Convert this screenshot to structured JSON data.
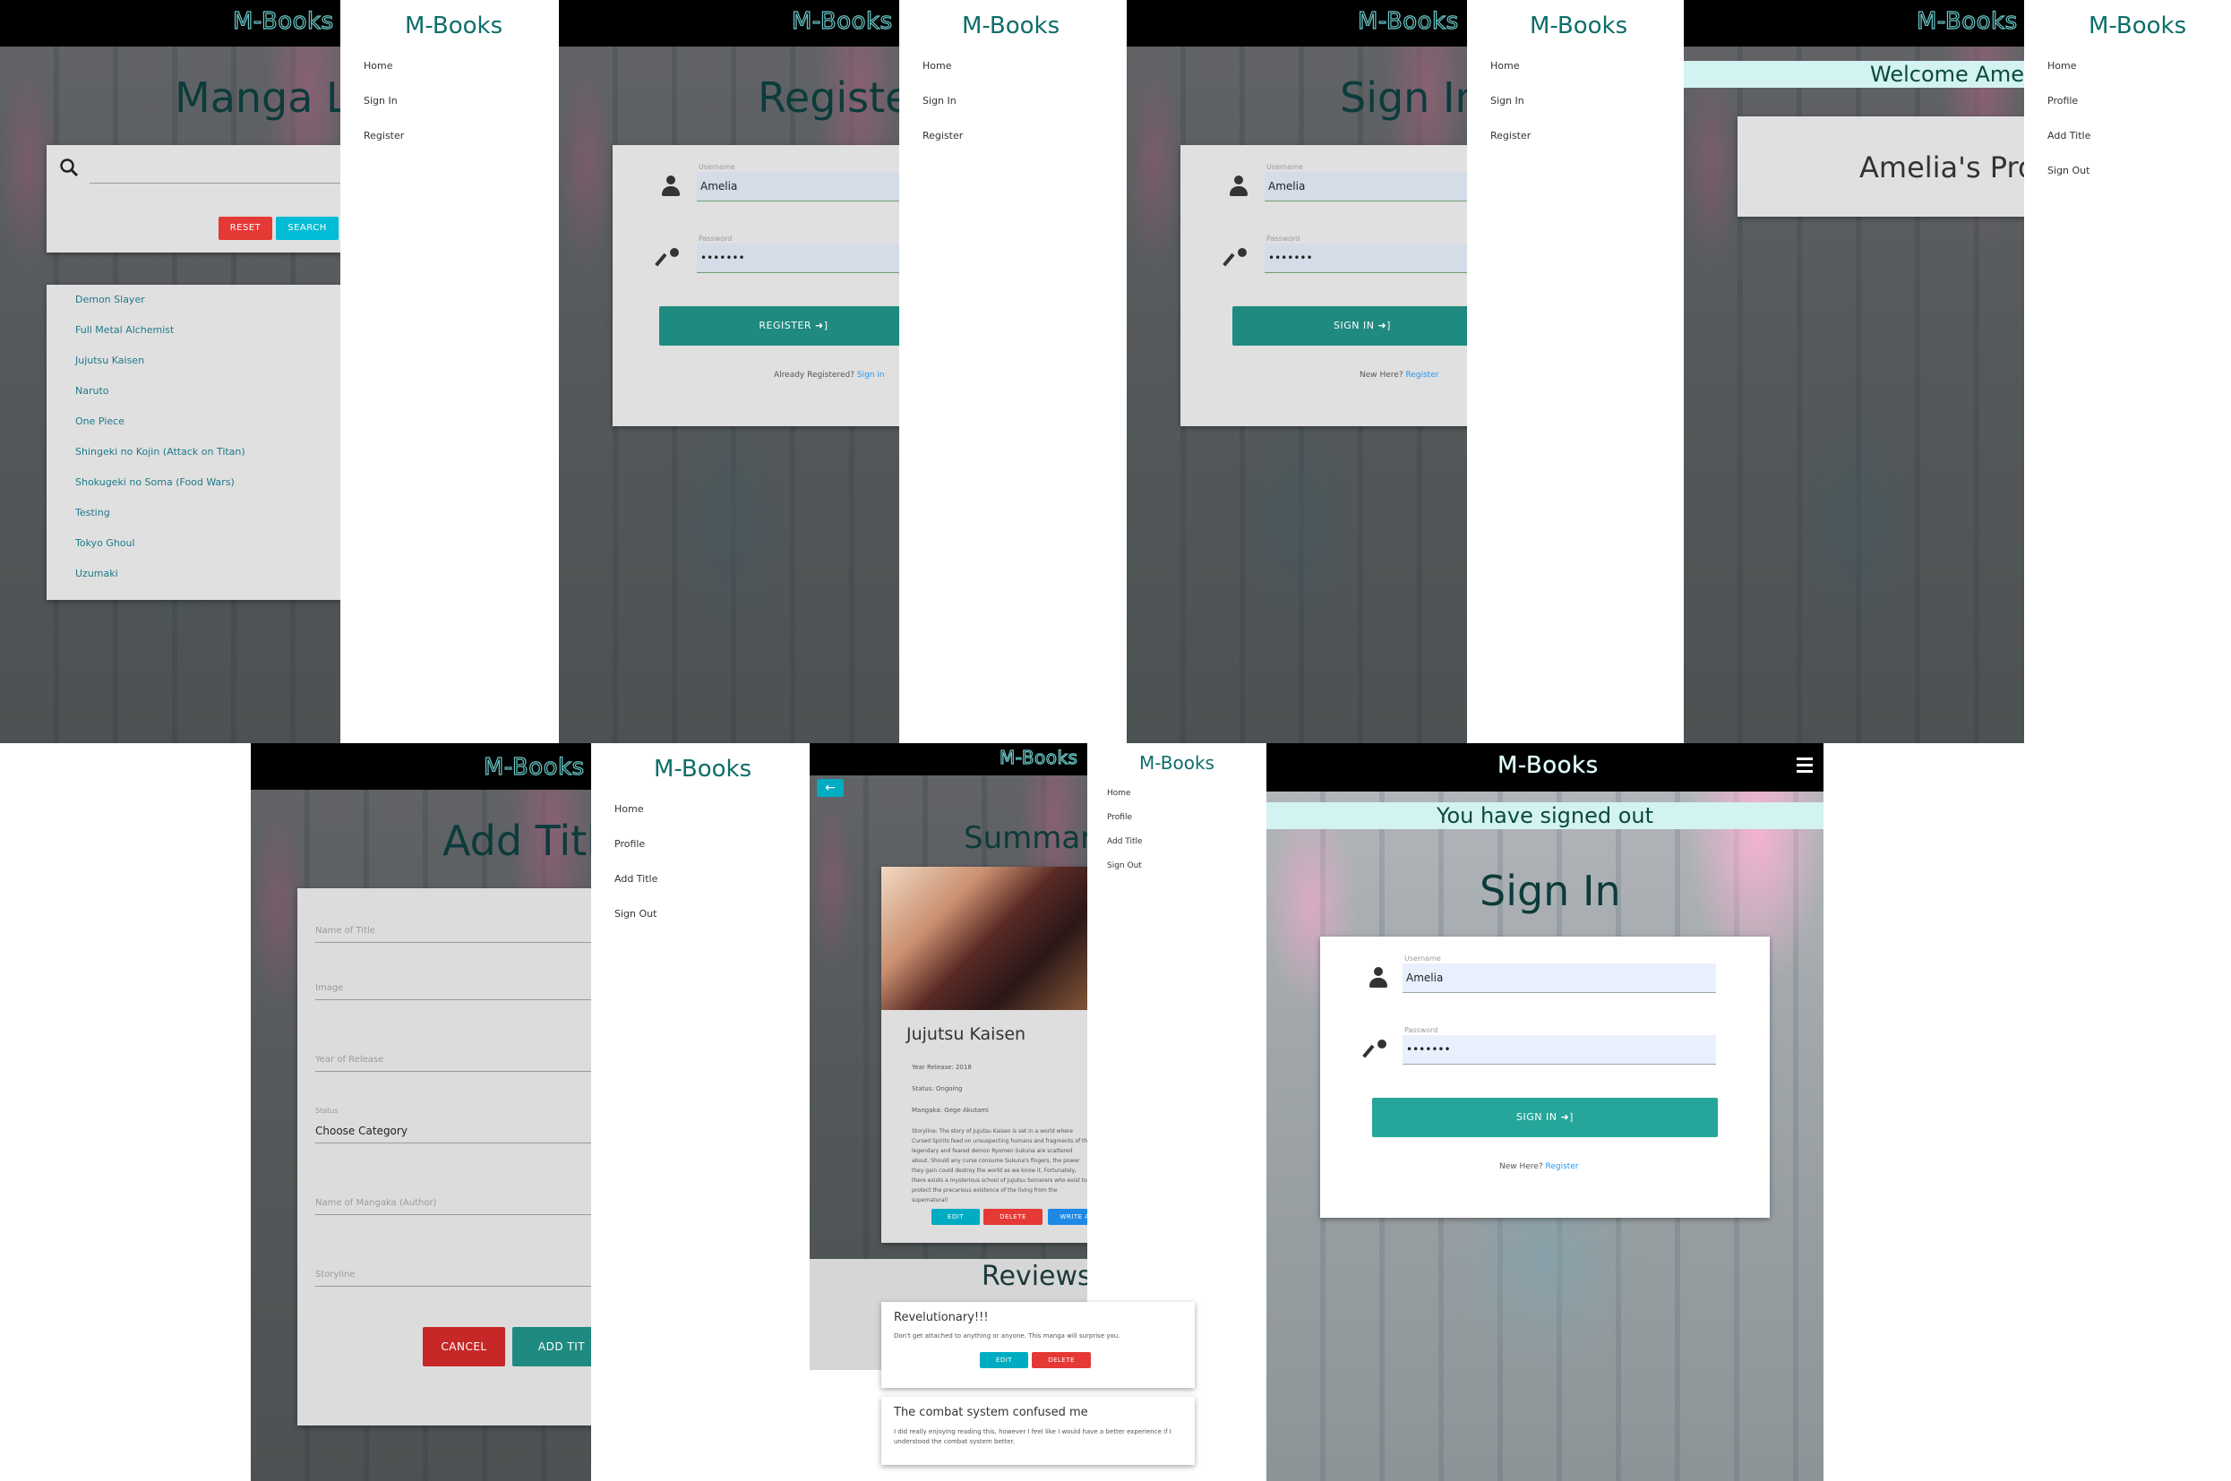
{
  "brand": "M-Books",
  "drawer_nav_guest": [
    "Home",
    "Sign In",
    "Register"
  ],
  "drawer_nav_user": [
    "Home",
    "Profile",
    "Add Title",
    "Sign Out"
  ],
  "manga_list": {
    "heading": "Manga L",
    "reset_label": "RESET",
    "search_label": "SEARCH",
    "items": [
      "Demon Slayer",
      "Full Metal Alchemist",
      "Jujutsu Kaisen",
      "Naruto",
      "One Piece",
      "Shingeki no Kojin (Attack on Titan)",
      "Shokugeki no Soma (Food Wars)",
      "Testing",
      "Tokyo Ghoul",
      "Uzumaki"
    ]
  },
  "register": {
    "heading": "Registe",
    "username_label": "Username",
    "username_value": "Amelia",
    "password_label": "Password",
    "password_value": "•••••••",
    "button_label": "REGISTER ➜]",
    "footer_text": "Already Registered?",
    "footer_link": "Sign in"
  },
  "signin": {
    "heading": "Sign In",
    "username_label": "Username",
    "username_value": "Amelia",
    "password_label": "Password",
    "password_value": "•••••••",
    "button_label": "SIGN IN ➜]",
    "footer_text": "New Here?",
    "footer_link": "Register"
  },
  "profile": {
    "welcome": "Welcome Ame",
    "heading": "Amelia's Pro"
  },
  "add_title": {
    "heading": "Add Titl",
    "fields": [
      "Name of Title",
      "Image",
      "Year of Release",
      "Name of Mangaka (Author)",
      "Storyline"
    ],
    "status_label": "Status",
    "status_value": "Choose Category",
    "cancel_label": "CANCEL",
    "add_label": "ADD TIT"
  },
  "summary": {
    "heading": "Summar",
    "title": "Jujutsu Kaisen",
    "year": "Year Release: 2018",
    "status": "Status: Ongoing",
    "mangaka": "Mangaka: Gege Akutami",
    "storyline": "Storyline: The story of Jujutsu Kaisen is set in a world where Cursed Spirits feed on unsuspecting humans and fragments of the legendary and feared demon Ryomen Sukuna are scattered about. Should any curse consume Sukuna's fingers, the power they gain could destroy the world as we know it. Fortunately, there exists a mysterious school of Jujutsu Sorcerers who exist to protect the precarious existence of the living from the supernatural!",
    "edit_label": "EDIT",
    "delete_label": "DELETE",
    "write_label": "WRITE A",
    "reviews_heading": "Reviews",
    "reviews": [
      {
        "title": "Revelutionary!!!",
        "body": "Don't get attached to anything or anyone. This manga will surprise you.",
        "edit": "EDIT",
        "delete": "DELETE"
      },
      {
        "title": "The combat system confused me",
        "body": "I did really enjoying reading this, however I feel like I would have a better experience if I understood the combat system better."
      }
    ]
  },
  "signed_out": {
    "banner": "You have signed out",
    "heading": "Sign In",
    "username_label": "Username",
    "username_value": "Amelia",
    "password_label": "Password",
    "password_value": "•••••••",
    "button_label": "SIGN IN ➜]",
    "footer_text": "New Here?",
    "footer_link": "Register"
  }
}
